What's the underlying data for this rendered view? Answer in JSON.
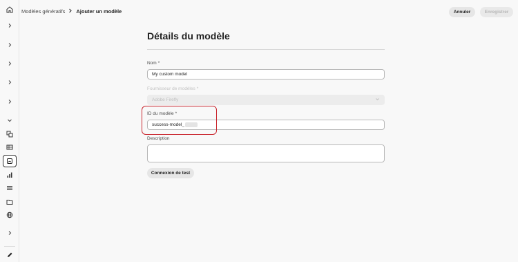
{
  "header": {
    "breadcrumb_parent": "Modèles génératifs",
    "breadcrumb_separator": ">",
    "breadcrumb_current": "Ajouter un modèle",
    "cancel_label": "Annuler",
    "save_label": "Enregistrer"
  },
  "form": {
    "title": "Détails du modèle",
    "name": {
      "label": "Nom",
      "required_mark": "*",
      "value": "My custom model"
    },
    "provider": {
      "label": "Fournisseur de modèles",
      "required_mark": "*",
      "value": "Adobe Firefly"
    },
    "model_id": {
      "label": "ID du modèle",
      "required_mark": "*",
      "value": "success-model_"
    },
    "description": {
      "label": "Description",
      "value": ""
    },
    "test_button_label": "Connexion de test"
  },
  "colors": {
    "highlight": "#c9252d",
    "background": "#f8f8f8",
    "disabled_text": "#c2c2c2"
  },
  "icons": {
    "rail": [
      "home-icon",
      "chevron-right-icon",
      "chevron-right-icon",
      "chevron-right-icon",
      "chevron-right-icon",
      "chevron-right-icon",
      "chevron-down-icon",
      "channels-icon",
      "table-icon",
      "generative-model-icon",
      "bar-chart-icon",
      "list-icon",
      "folder-icon",
      "globe-icon",
      "chevron-right-icon",
      "pencil-icon"
    ]
  }
}
